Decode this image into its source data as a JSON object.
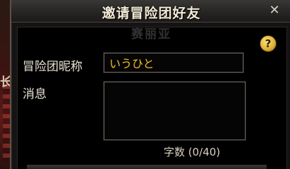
{
  "dialog": {
    "title": "邀请冒险团好友",
    "close_icon": "close-icon",
    "close_glyph": "✕",
    "ghost_name": "赛丽亚",
    "help_icon": "help-icon",
    "help_glyph": "?"
  },
  "form": {
    "nickname_label": "冒险团昵称",
    "nickname_value": "いうひと",
    "message_label": "消息",
    "message_value": "",
    "char_count": "字数 (0/40)"
  },
  "background": {
    "edge_glyph": "长"
  },
  "colors": {
    "title_text": "#f2ead6",
    "input_text": "#f0c020",
    "label_text": "#e8e2d4",
    "help_icon_fill": "#e0b43a"
  }
}
